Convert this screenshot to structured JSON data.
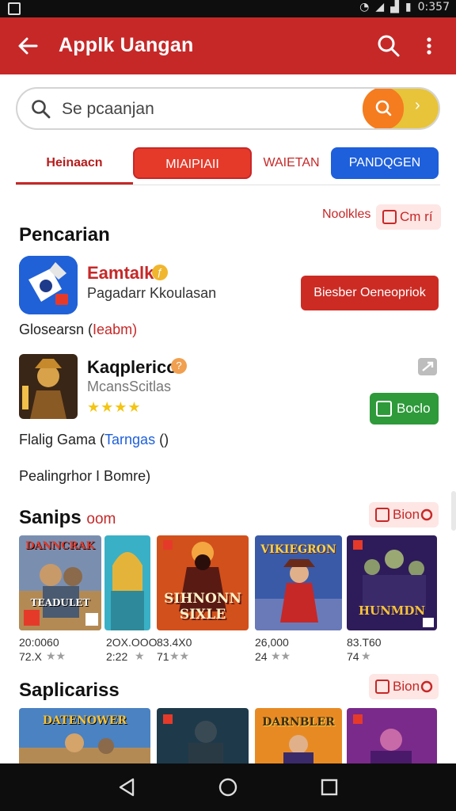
{
  "status_bar": {
    "time": "0:357"
  },
  "appbar": {
    "title": "Applk Uangan",
    "back_icon": "arrow-left-icon",
    "search_icon": "search-icon",
    "more_icon": "more-vert-icon"
  },
  "search": {
    "value": "Se pcaanjan",
    "placeholder": "Se pcaanjan"
  },
  "tabs": [
    {
      "label": "Heinaacn"
    },
    {
      "label": "MIAIPIAII"
    },
    {
      "label": "WAIETAN"
    },
    {
      "label": "PANDQGEN"
    }
  ],
  "pencarian": {
    "title": "Pencarian",
    "notice_label": "Noolkles",
    "pill_label": "Cm rí"
  },
  "app1": {
    "name": "Eamtalk",
    "sub": "Pagadarr Kkoulasan",
    "cta": "Biesber Oeneopriok",
    "badge": "ƒ"
  },
  "meta1": {
    "left": "Glosearsn (",
    "link": "Ieabm",
    "right": ")"
  },
  "app2": {
    "name": "Kaqplerico",
    "sub": "McansScitlas",
    "cta": "Boclo",
    "stars": "★★★★",
    "badge": "?"
  },
  "meta2": {
    "left": "Flalig Gama (",
    "link": "Tarngas",
    "right": " ()"
  },
  "meta3": {
    "text": "Pealingrhor I Bomre)"
  },
  "sanips": {
    "title": "Sanips",
    "suffix": "oom",
    "pill_label": "Bion"
  },
  "games": [
    {
      "title": "TEADULET",
      "banner": "DANNCRAK",
      "stat1": "20:0060",
      "stat2": "72.X",
      "stars": "★★"
    },
    {
      "title": "",
      "banner": "",
      "stat1": "2OX.OOO",
      "stat2": "2:22",
      "stars": "★"
    },
    {
      "title": "SIHNONN SIXLE",
      "banner": "",
      "stat1": "83.4X0",
      "stat2": "71",
      "stars": "★★"
    },
    {
      "title": "",
      "banner": "VIKIEGRON",
      "stat1": "26,000",
      "stat2": "24",
      "stars": "★★"
    },
    {
      "title": "HUNMDN",
      "banner": "",
      "stat1": "83.T60",
      "stat2": "74",
      "stars": "★"
    }
  ],
  "saplicariss": {
    "title": "Saplicariss",
    "pill_label": "Bion"
  },
  "games2": [
    {
      "banner": "DATENOWER"
    },
    {
      "banner": ""
    },
    {
      "banner": "DARNBLER"
    },
    {
      "banner": ""
    }
  ],
  "colors": {
    "primary": "#c62828",
    "accent_blue": "#1e5fdb",
    "accent_green": "#2e9a3a",
    "search_orange": "#f57c1f",
    "search_yellow": "#e7c43a"
  }
}
